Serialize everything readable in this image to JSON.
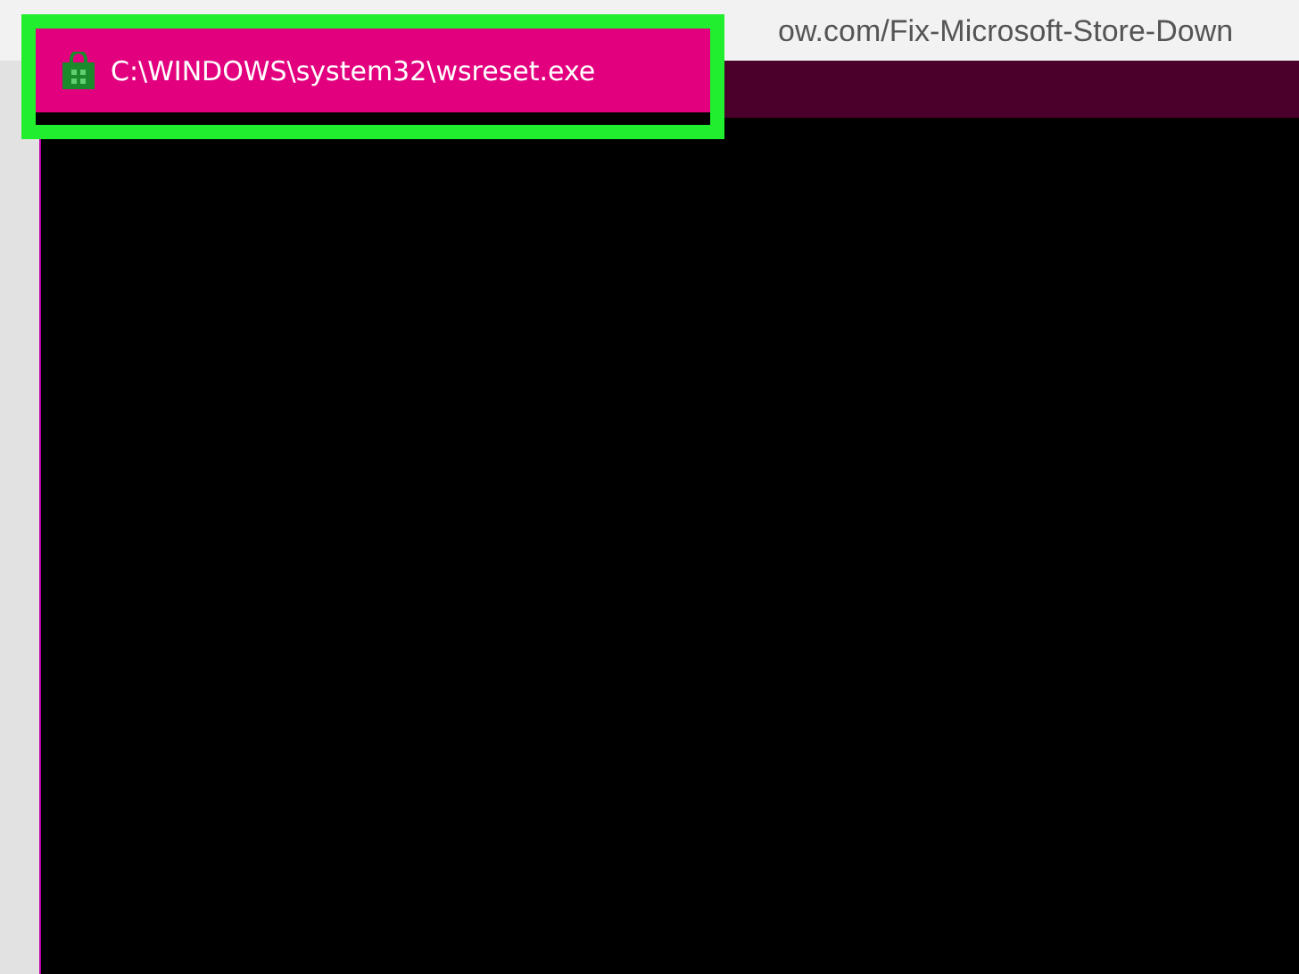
{
  "browser": {
    "address": "ow.com/Fix-Microsoft-Store-Down"
  },
  "window": {
    "title": "C:\\WINDOWS\\system32\\wsreset.exe",
    "title_highlighted": true
  }
}
